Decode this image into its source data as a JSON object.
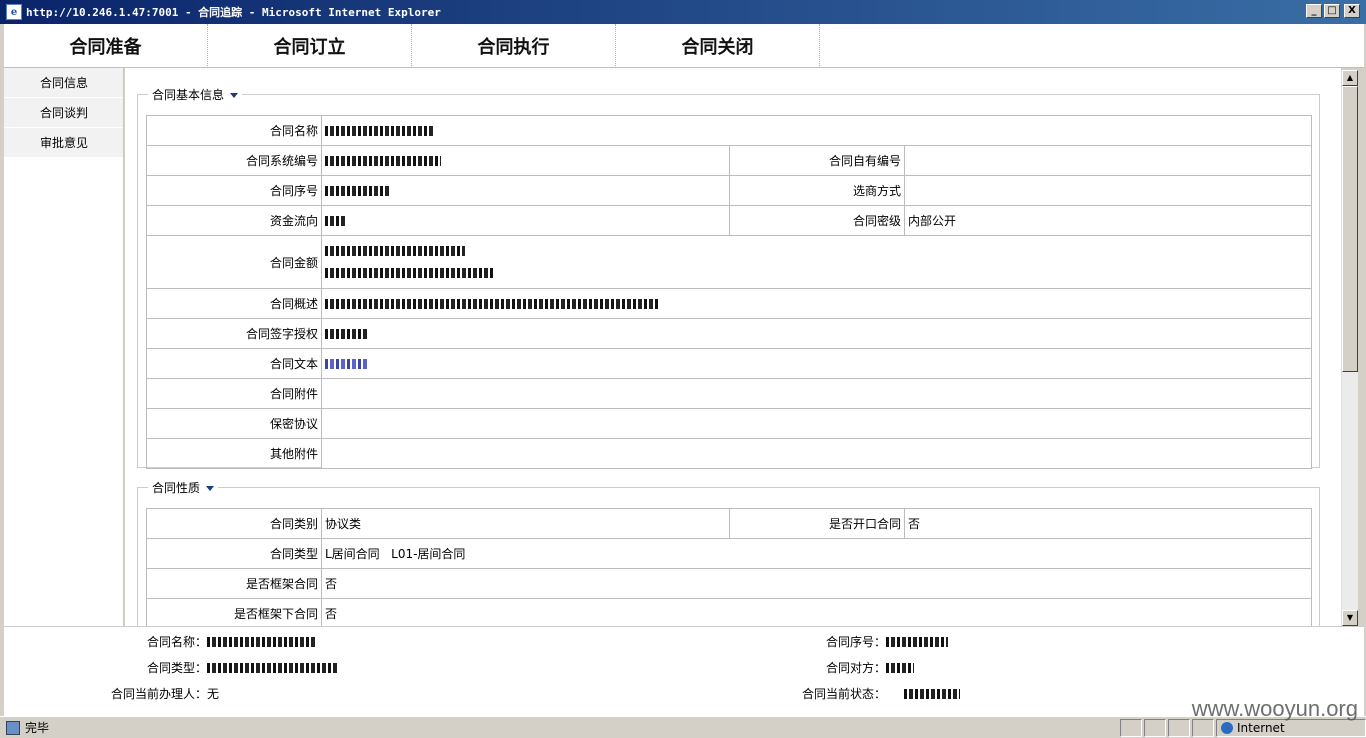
{
  "window": {
    "title": "http://10.246.1.47:7001 - 合同追踪 - Microsoft Internet Explorer",
    "buttons": [
      "_",
      "□",
      "X"
    ]
  },
  "topnav": {
    "tabs": [
      "合同准备",
      "合同订立",
      "合同执行",
      "合同关闭"
    ]
  },
  "sidebar": {
    "items": [
      "合同信息",
      "合同谈判",
      "审批意见"
    ]
  },
  "section_basic": {
    "legend": "合同基本信息",
    "labels": {
      "name": "合同名称",
      "sysno": "合同系统编号",
      "ownno": "合同自有编号",
      "seq": "合同序号",
      "select": "选商方式",
      "flow": "资金流向",
      "secret": "合同密级",
      "amount": "合同金额",
      "summary": "合同概述",
      "sign": "合同签字授权",
      "text": "合同文本",
      "attach": "合同附件",
      "nda": "保密协议",
      "other": "其他附件"
    },
    "values": {
      "secret": "内部公开"
    }
  },
  "section_nature": {
    "legend": "合同性质",
    "labels": {
      "category": "合同类别",
      "open": "是否开口合同",
      "type": "合同类型",
      "frame": "是否框架合同",
      "under_frame": "是否框架下合同"
    },
    "values": {
      "category": "协议类",
      "open": "否",
      "type": "L居间合同   L01-居间合同",
      "frame": "否",
      "under_frame": "否"
    }
  },
  "footer": {
    "name_label": "合同名称：",
    "type_label": "合同类型：",
    "handler_label": "合同当前办理人：",
    "handler_value": "无",
    "seq_label": "合同序号：",
    "party_label": "合同对方：",
    "status_label": "合同当前状态："
  },
  "statusbar": {
    "text": "完毕",
    "zone": "Internet"
  },
  "watermark": "www.wooyun.org"
}
